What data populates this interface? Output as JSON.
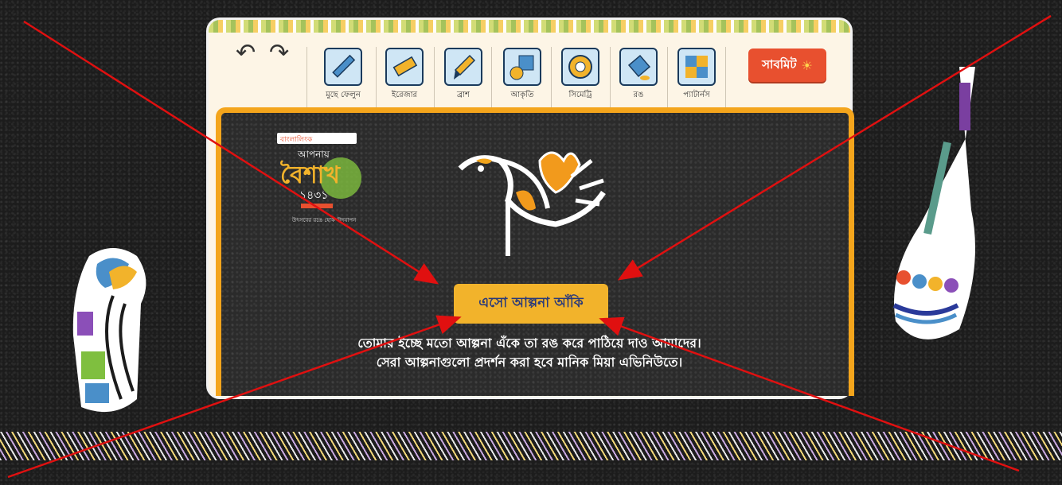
{
  "toolbar": {
    "tools": [
      {
        "label": "মুছে ফেলুন",
        "icon": "ruler-icon"
      },
      {
        "label": "ইরেজার",
        "icon": "eraser-icon"
      },
      {
        "label": "ব্রাশ",
        "icon": "brush-icon"
      },
      {
        "label": "আকৃতি",
        "icon": "shapes-icon"
      },
      {
        "label": "সিমেট্রি",
        "icon": "symmetry-icon"
      },
      {
        "label": "রঙ",
        "icon": "paint-bucket-icon"
      },
      {
        "label": "প্যাটার্নস",
        "icon": "puzzle-icon"
      }
    ],
    "submit_label": "সাবমিট"
  },
  "canvas": {
    "cta_label": "এসো আল্পনা আঁকি",
    "description_line1": "তোমার ইচ্ছে মতো আল্পনা এঁকে তা রঙ করে পাঠিয়ে দাও আমাদের।",
    "description_line2": "সেরা আল্পনাগুলো প্রদর্শন করা হবে মানিক মিয়া এভিনিউতে।"
  },
  "event_logo": {
    "sponsor": "বাংলালিংক",
    "line1": "আপনায়",
    "title": "বৈশাখ",
    "year": "১৪৩১",
    "tagline": "উৎসবের রঙে হোক উদযাপন"
  },
  "colors": {
    "accent": "#f4a51c",
    "submit": "#e8502f",
    "cta": "#f2b32b",
    "annotation": "#e01010"
  }
}
